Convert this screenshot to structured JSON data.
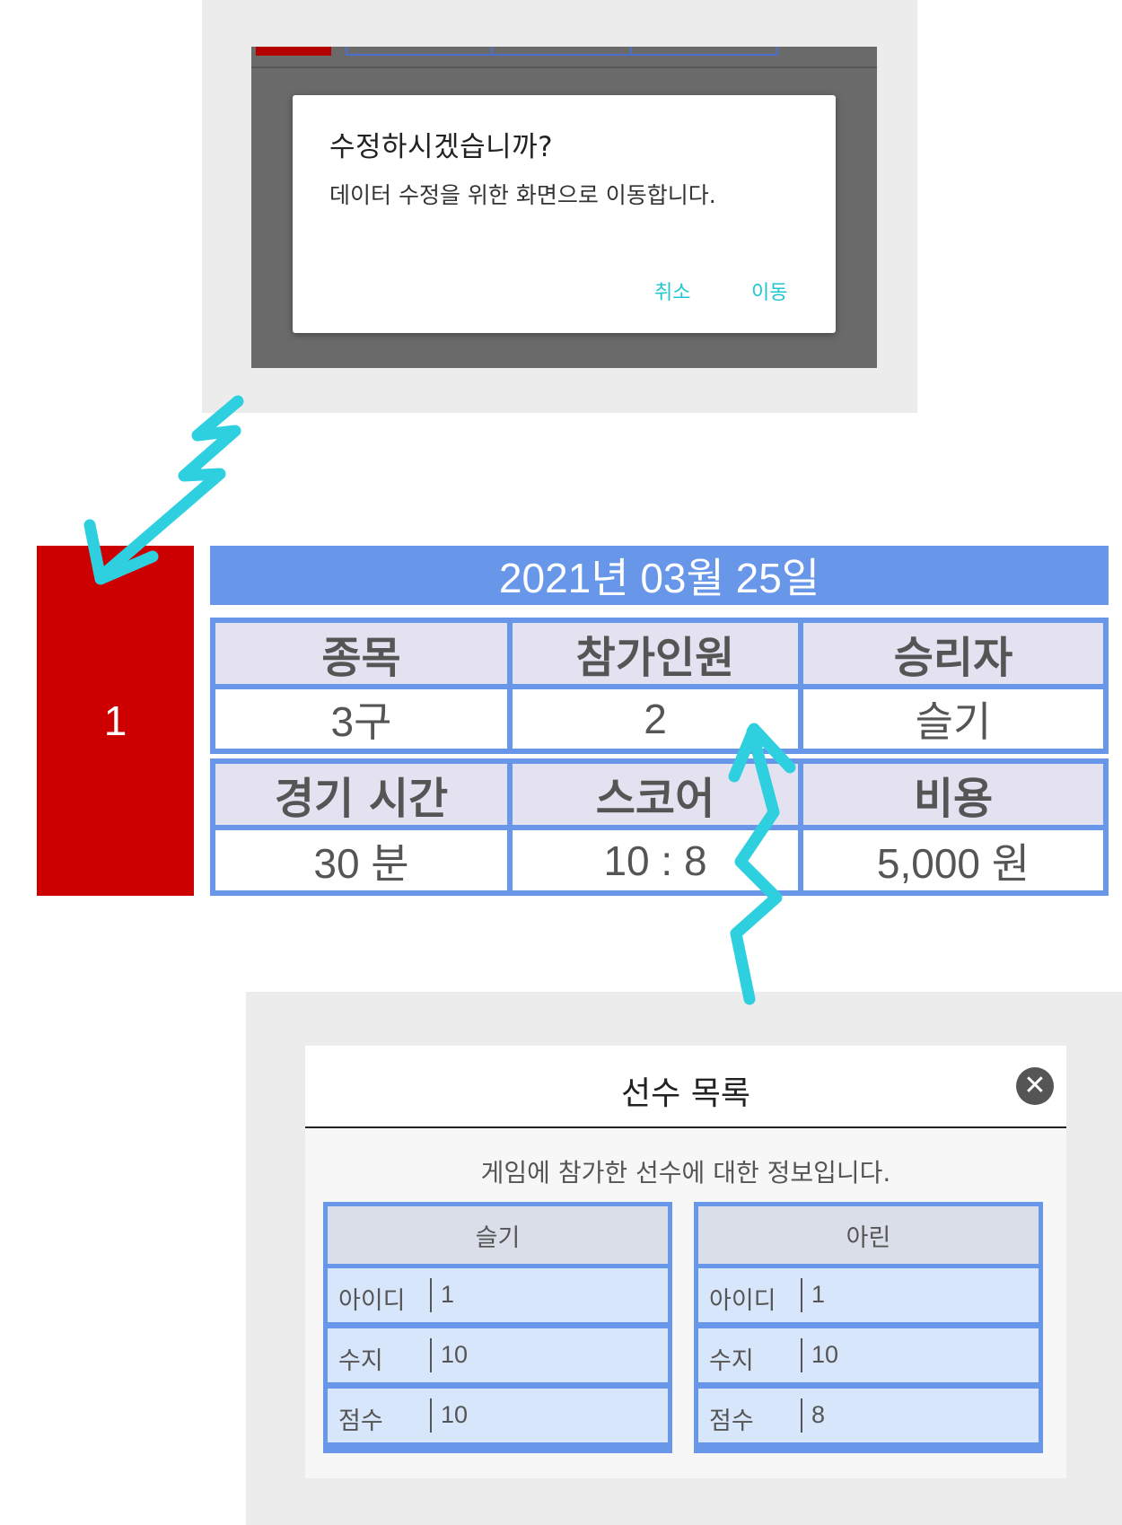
{
  "confirm_dialog": {
    "title": "수정하시겠습니까?",
    "message": "데이터 수정을 위한 화면으로 이동합니다.",
    "cancel_label": "취소",
    "confirm_label": "이동",
    "accent_color": "#1fc6cf"
  },
  "game_card": {
    "number": "1",
    "date": "2021년 03월 25일",
    "row1_headers": [
      "종목",
      "참가인원",
      "승리자"
    ],
    "row1_values": [
      "3구",
      "2",
      "슬기"
    ],
    "row2_headers": [
      "경기 시간",
      "스코어",
      "비용"
    ],
    "row2_values": [
      "30 분",
      "10 : 8",
      "5,000 원"
    ],
    "number_color": "#cc0000",
    "accent_color": "#6897ea"
  },
  "player_modal": {
    "title": "선수 목록",
    "description": "게임에 참가한 선수에 대한 정보입니다.",
    "players": [
      {
        "name": "슬기",
        "rows": [
          {
            "label": "아이디",
            "value": "1"
          },
          {
            "label": "수지",
            "value": "10"
          },
          {
            "label": "점수",
            "value": "10"
          }
        ]
      },
      {
        "name": "아린",
        "rows": [
          {
            "label": "아이디",
            "value": "1"
          },
          {
            "label": "수지",
            "value": "10"
          },
          {
            "label": "점수",
            "value": "8"
          }
        ]
      }
    ]
  },
  "annotation_color": "#2ed0e0"
}
